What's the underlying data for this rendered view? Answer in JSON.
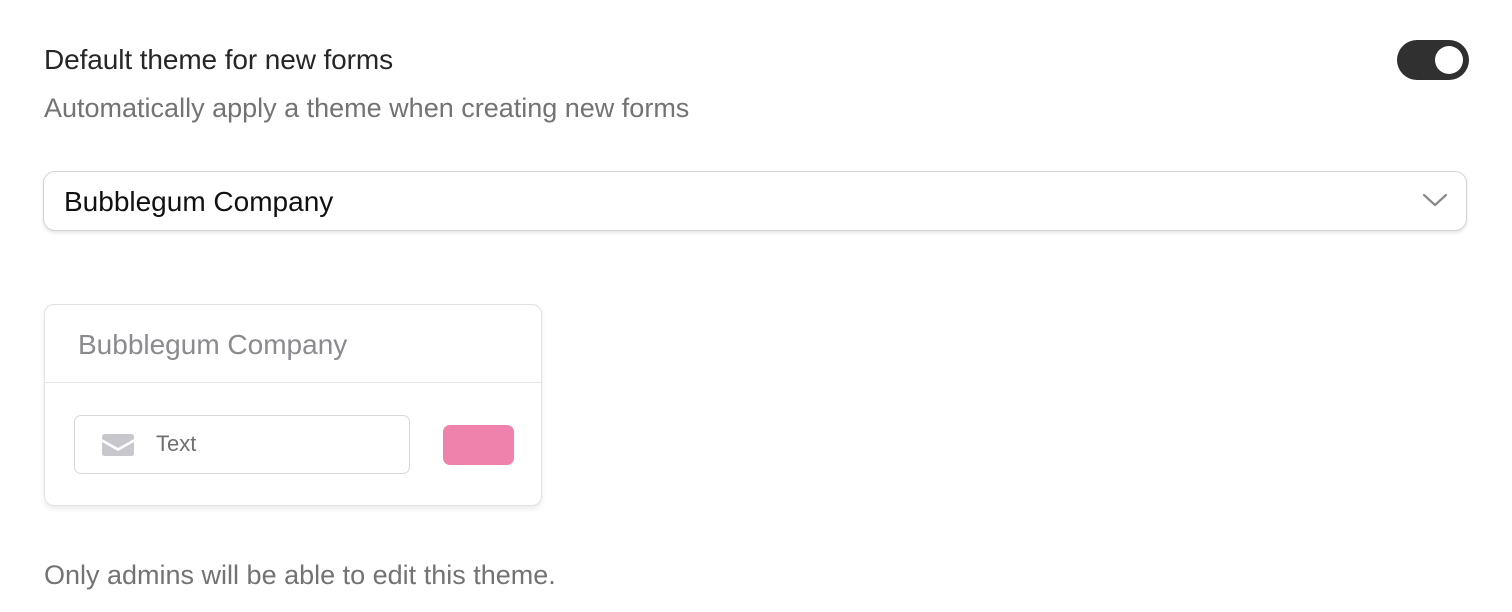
{
  "setting": {
    "title": "Default theme for new forms",
    "description": "Automatically apply a theme when creating new forms",
    "toggle_on": true
  },
  "theme_select": {
    "selected": "Bubblegum Company"
  },
  "preview": {
    "title": "Bubblegum Company",
    "input_text": "Text",
    "button_color": "#ee82ac"
  },
  "footer_note": "Only admins will be able to edit this theme."
}
